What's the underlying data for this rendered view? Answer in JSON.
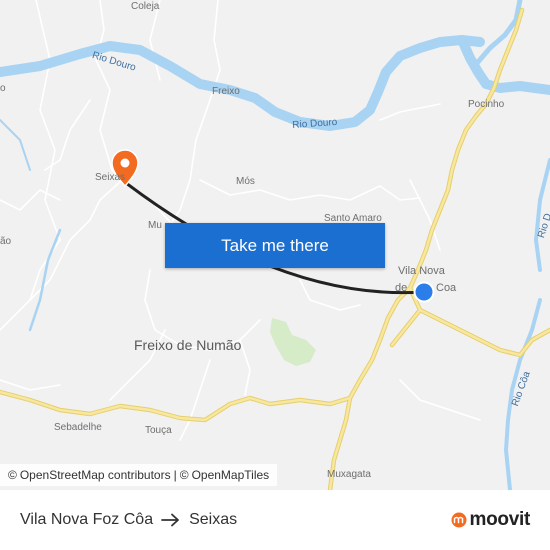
{
  "map": {
    "labels": {
      "coleja": "Coleja",
      "seixas": "Seixas",
      "freixo": "Freixo",
      "mos": "Mós",
      "santo_amaro": "Santo Amaro",
      "pocinho": "Pocinho",
      "vila_nova_line1": "Vila Nova",
      "vila_nova_line2a": "de",
      "vila_nova_line2b": "Coa",
      "mu": "Mu",
      "freixo_de_numao": "Freixo de Numão",
      "sebadelhe": "Sebadelhe",
      "touca": "Touça",
      "muxagata": "Muxagata",
      "left_o": "o",
      "left_ao": "ão"
    },
    "rivers": {
      "douro_1": "Rio Douro",
      "douro_2": "Rio Douro",
      "coa": "Rio Côa",
      "right_d": "Rio D"
    },
    "markers": {
      "origin": "Vila Nova Foz Côa",
      "destination": "Seixas"
    },
    "colors": {
      "land": "#f1f1f1",
      "water": "#a9d3f2",
      "major_road": "#f5e28a",
      "minor_road": "#ffffff",
      "route_line": "#222222",
      "origin_marker": "#2b7de9",
      "destination_marker": "#f26b21",
      "button": "#1a6fd1",
      "moovit_orange": "#f26b21"
    }
  },
  "cta": {
    "label": "Take me there"
  },
  "attribution": {
    "symbol": "©",
    "osm": "OpenStreetMap contributors",
    "separator": "|",
    "omt": "OpenMapTiles"
  },
  "footer": {
    "origin": "Vila Nova Foz Côa",
    "arrow_icon": "arrow-right-icon",
    "destination": "Seixas",
    "brand": "moovit"
  }
}
